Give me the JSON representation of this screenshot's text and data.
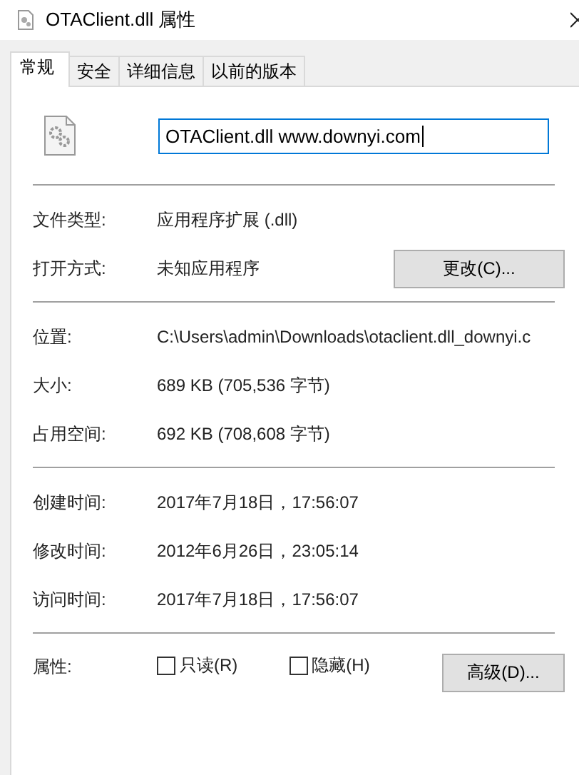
{
  "window": {
    "title": "OTAClient.dll 属性"
  },
  "tabs": [
    {
      "label": "常规",
      "selected": true
    },
    {
      "label": "安全",
      "selected": false
    },
    {
      "label": "详细信息",
      "selected": false
    },
    {
      "label": "以前的版本",
      "selected": false
    }
  ],
  "file_name": {
    "value": "OTAClient.dll www.downyi.com"
  },
  "sections": [
    [
      {
        "label": "文件类型:",
        "value": "应用程序扩展 (.dll)"
      },
      {
        "label": "打开方式:",
        "value": "未知应用程序",
        "button": "更改(C)..."
      }
    ],
    [
      {
        "label": "位置:",
        "value": "C:\\Users\\admin\\Downloads\\otaclient.dll_downyi.c"
      },
      {
        "label": "大小:",
        "value": "689 KB (705,536 字节)"
      },
      {
        "label": "占用空间:",
        "value": "692 KB (708,608 字节)"
      }
    ],
    [
      {
        "label": "创建时间:",
        "value": "2017年7月18日，17:56:07"
      },
      {
        "label": "修改时间:",
        "value": "2012年6月26日，23:05:14"
      },
      {
        "label": "访问时间:",
        "value": "2017年7月18日，17:56:07"
      }
    ]
  ],
  "attributes": {
    "label": "属性:",
    "checkboxes": [
      {
        "label": "只读(R)",
        "checked": false
      },
      {
        "label": "隐藏(H)",
        "checked": false
      }
    ],
    "button": "高级(D)..."
  }
}
